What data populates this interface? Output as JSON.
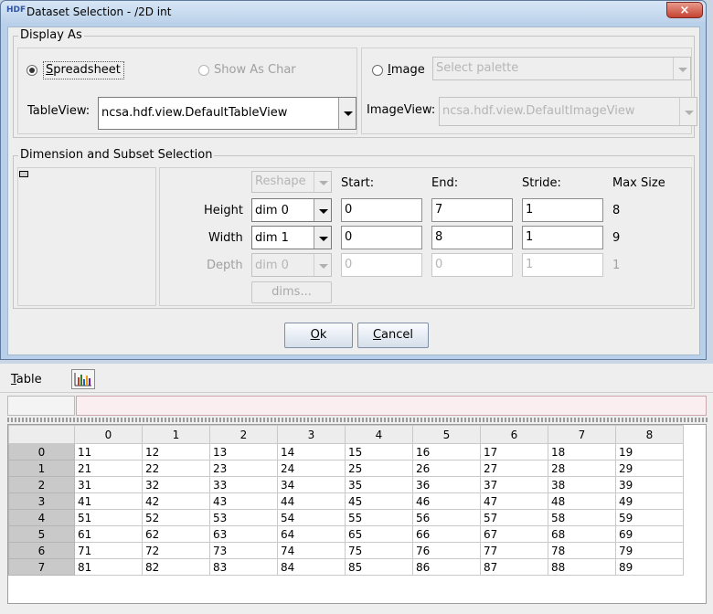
{
  "dialog": {
    "title": "Dataset Selection - /2D int",
    "app_icon": "HDF",
    "close_glyph": "×",
    "display_as": {
      "title": "Display As",
      "spreadsheet_label": "Spreadsheet",
      "show_as_char_label": "Show As Char",
      "tableview_label": "TableView:",
      "tableview_value": "ncsa.hdf.view.DefaultTableView",
      "image_label": "Image",
      "palette_value": "Select palette",
      "imageview_label": "ImageView:",
      "imageview_value": "ncsa.hdf.view.DefaultImageView"
    },
    "dimension": {
      "title": "Dimension and Subset Selection",
      "reshape": "Reshape",
      "headers": {
        "start": "Start:",
        "end": "End:",
        "stride": "Stride:",
        "max": "Max Size"
      },
      "rows": [
        {
          "label": "Height",
          "dim": "dim 0",
          "start": "0",
          "end": "7",
          "stride": "1",
          "max": "8"
        },
        {
          "label": "Width",
          "dim": "dim 1",
          "start": "0",
          "end": "8",
          "stride": "1",
          "max": "9"
        },
        {
          "label": "Depth",
          "dim": "dim 0",
          "start": "0",
          "end": "0",
          "stride": "1",
          "max": "1"
        }
      ],
      "dims_button": "dims..."
    },
    "ok": "Ok",
    "cancel": "Cancel"
  },
  "viewer": {
    "menu_table": "Table",
    "chart_icon": "chart-icon",
    "columns": [
      "0",
      "1",
      "2",
      "3",
      "4",
      "5",
      "6",
      "7",
      "8"
    ],
    "rows": [
      {
        "h": "0",
        "v": [
          "11",
          "12",
          "13",
          "14",
          "15",
          "16",
          "17",
          "18",
          "19"
        ]
      },
      {
        "h": "1",
        "v": [
          "21",
          "22",
          "23",
          "24",
          "25",
          "26",
          "27",
          "28",
          "29"
        ]
      },
      {
        "h": "2",
        "v": [
          "31",
          "32",
          "33",
          "34",
          "35",
          "36",
          "37",
          "38",
          "39"
        ]
      },
      {
        "h": "3",
        "v": [
          "41",
          "42",
          "43",
          "44",
          "45",
          "46",
          "47",
          "48",
          "49"
        ]
      },
      {
        "h": "4",
        "v": [
          "51",
          "52",
          "53",
          "54",
          "55",
          "56",
          "57",
          "58",
          "59"
        ]
      },
      {
        "h": "5",
        "v": [
          "61",
          "62",
          "63",
          "64",
          "65",
          "66",
          "67",
          "68",
          "69"
        ]
      },
      {
        "h": "6",
        "v": [
          "71",
          "72",
          "73",
          "74",
          "75",
          "76",
          "77",
          "78",
          "79"
        ]
      },
      {
        "h": "7",
        "v": [
          "81",
          "82",
          "83",
          "84",
          "85",
          "86",
          "87",
          "88",
          "89"
        ]
      }
    ]
  }
}
